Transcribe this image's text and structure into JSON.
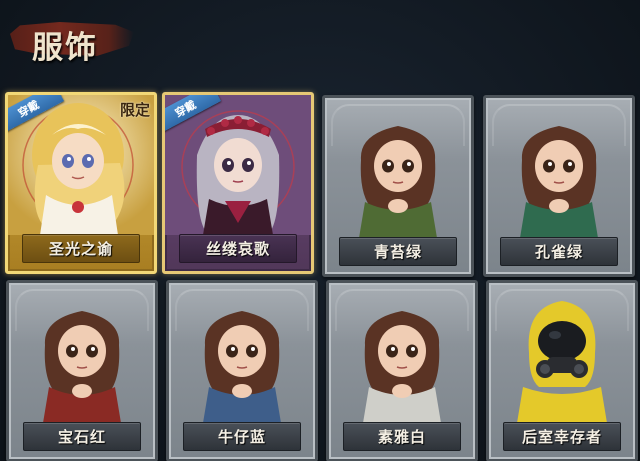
{
  "section": {
    "title": "服饰"
  },
  "outfits": [
    {
      "name": "圣光之谕",
      "frame": "gold",
      "equipped_label": "穿戴",
      "limited_label": "限定",
      "portrait": "blonde-girl-white-dress"
    },
    {
      "name": "丝缕哀歌",
      "frame": "purple",
      "equipped_label": "穿戴",
      "portrait": "silver-hair-red-headband"
    },
    {
      "name": "青苔绿",
      "frame": "gray",
      "portrait": "brunette-girl-green-coat"
    },
    {
      "name": "孔雀绿",
      "frame": "gray",
      "portrait": "brunette-girl-teal-coat"
    },
    {
      "name": "宝石红",
      "frame": "gray",
      "portrait": "brunette-girl-red-coat"
    },
    {
      "name": "牛仔蓝",
      "frame": "gray",
      "portrait": "brunette-girl-blue-coat"
    },
    {
      "name": "素雅白",
      "frame": "gray",
      "portrait": "brunette-girl-white-coat"
    },
    {
      "name": "后室幸存者",
      "frame": "gray",
      "portrait": "yellow-hazmat-gas-mask"
    }
  ],
  "colors": {
    "frame_gold": "#d9b650",
    "frame_purple": "#7d5a8a",
    "frame_gray": "#8b9299",
    "equipped_tag": "#3f7fc0",
    "header_brush": "#7a2a1e"
  }
}
